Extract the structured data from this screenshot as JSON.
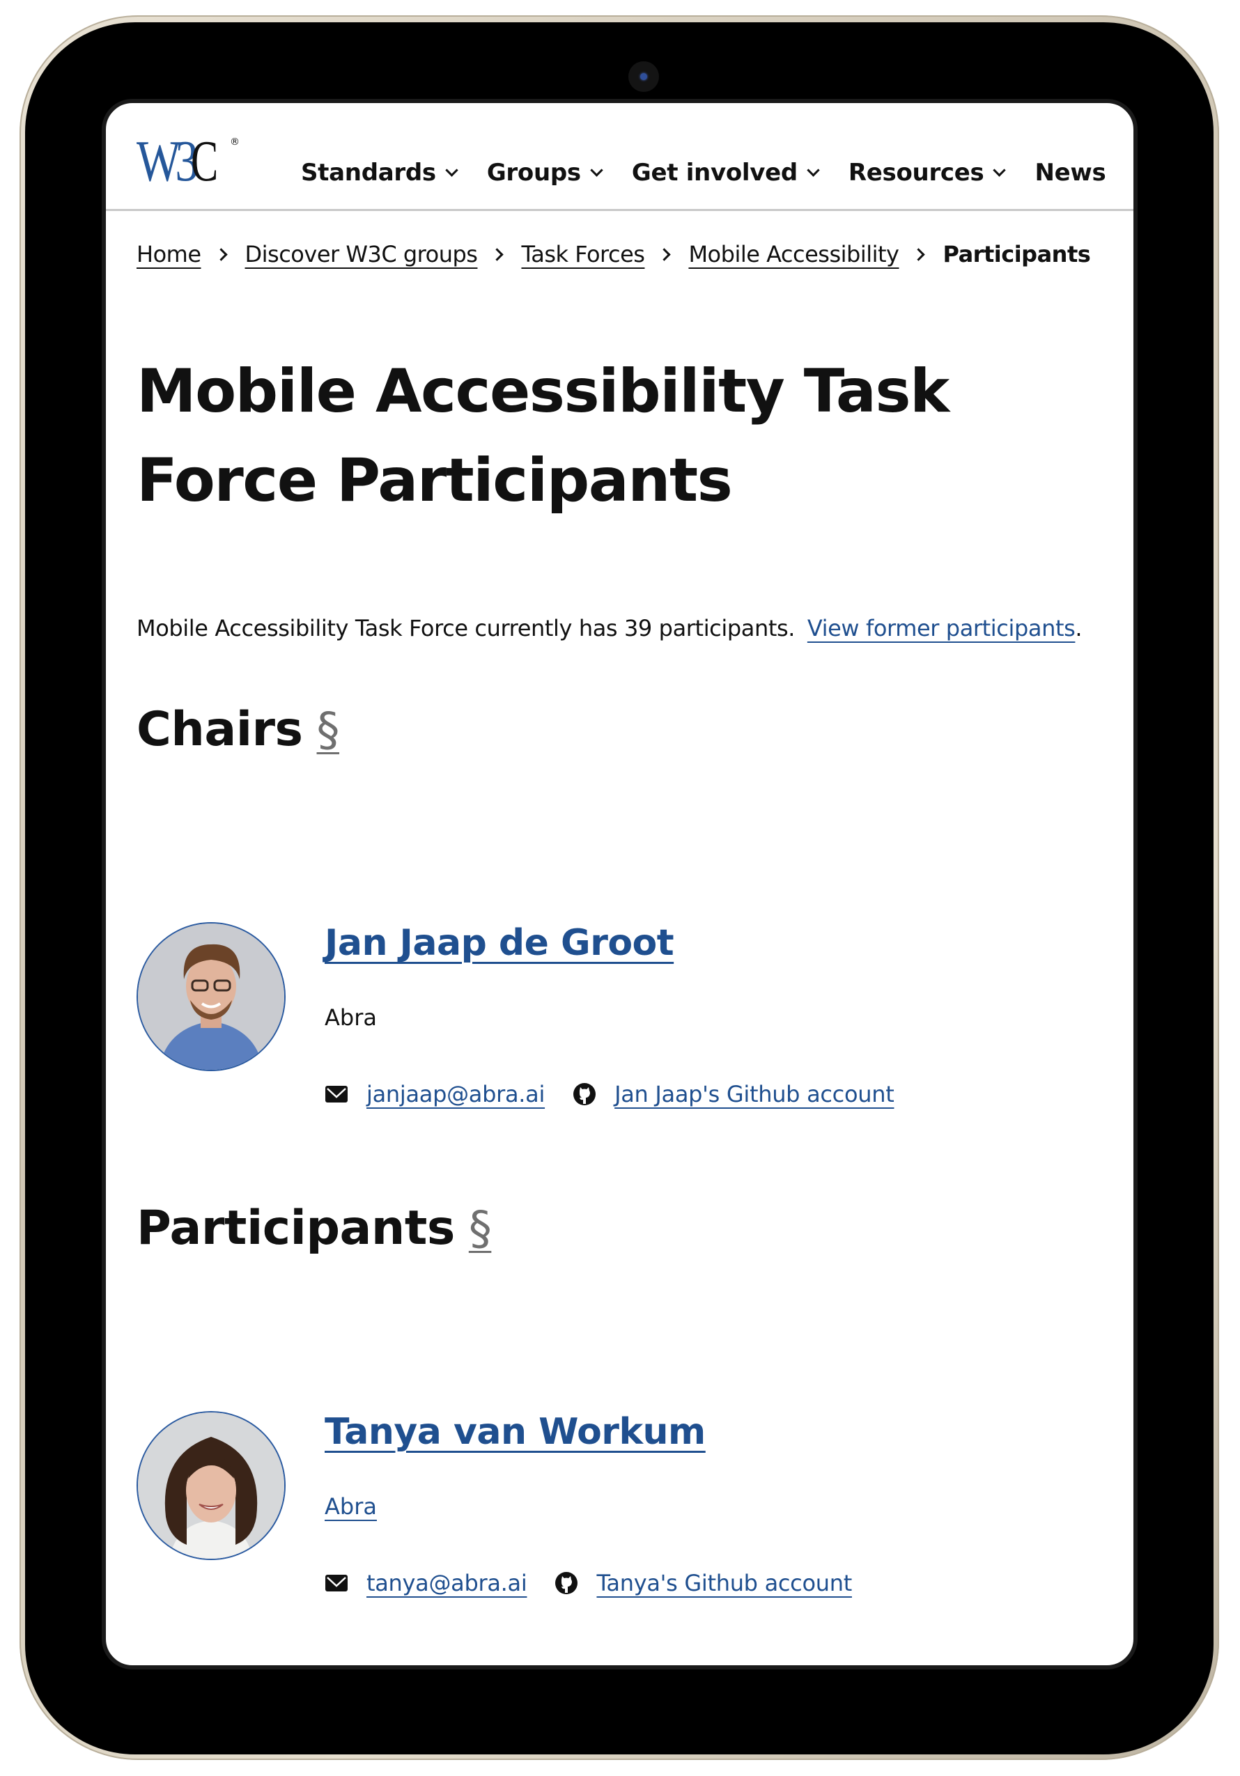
{
  "device": {
    "type": "tablet"
  },
  "header": {
    "logo": {
      "text": "W3",
      "c": "C",
      "reg": "®",
      "alt": "W3C"
    },
    "nav": [
      {
        "label": "Standards",
        "has_dropdown": true
      },
      {
        "label": "Groups",
        "has_dropdown": true
      },
      {
        "label": "Get involved",
        "has_dropdown": true
      },
      {
        "label": "Resources",
        "has_dropdown": true
      },
      {
        "label": "News",
        "has_dropdown": false
      }
    ]
  },
  "breadcrumb": {
    "items": [
      {
        "label": "Home"
      },
      {
        "label": "Discover W3C groups"
      },
      {
        "label": "Task Forces"
      },
      {
        "label": "Mobile Accessibility"
      }
    ],
    "current": "Participants"
  },
  "page": {
    "title": "Mobile Accessibility Task Force Participants",
    "intro_text": "Mobile Accessibility Task Force currently has 39 participants.",
    "participant_count": 39,
    "former_link": "View former participants",
    "intro_end": "."
  },
  "sections": {
    "chairs": {
      "heading": "Chairs",
      "anchor": "§",
      "people": [
        {
          "name": "Jan Jaap de Groot",
          "organization": "Abra",
          "organization_is_link": false,
          "email": "janjaap@abra.ai",
          "github": "Jan Jaap's Github account",
          "avatar_icon": "person-photo"
        }
      ]
    },
    "participants": {
      "heading": "Participants",
      "anchor": "§",
      "people": [
        {
          "name": "Tanya van Workum",
          "organization": "Abra",
          "organization_is_link": true,
          "email": "tanya@abra.ai",
          "github": "Tanya's Github account",
          "avatar_icon": "person-photo"
        }
      ]
    }
  },
  "icons": {
    "email": "envelope-icon",
    "github": "github-icon",
    "dropdown": "chevron-down-icon",
    "breadcrumb_sep": "chevron-right-icon"
  },
  "colors": {
    "link": "#1f4f8f",
    "logo_blue": "#25579a",
    "text": "#111111",
    "anchor": "#6f6f6f",
    "divider": "#c8c8c8"
  }
}
